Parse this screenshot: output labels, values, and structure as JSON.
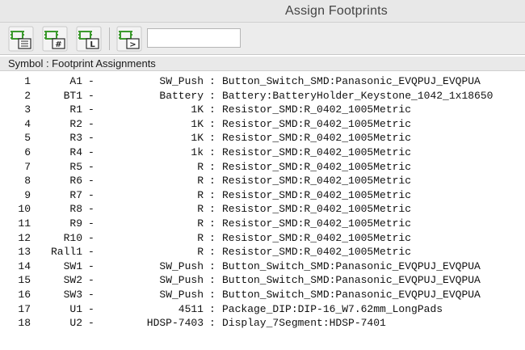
{
  "window": {
    "title": "Assign Footprints"
  },
  "toolbar": {
    "buttons": [
      {
        "name": "view-symbol-list",
        "label": ""
      },
      {
        "name": "filter-by-pin-count",
        "label": "#"
      },
      {
        "name": "filter-by-library",
        "label": "L"
      },
      {
        "name": "filter-by-text",
        "label": ">"
      }
    ],
    "filter_value": "",
    "filter_placeholder": ""
  },
  "panel": {
    "header": "Symbol : Footprint Assignments"
  },
  "separators": {
    "dash": "-",
    "colon": ":"
  },
  "colors": {
    "icon_green": "#3c9a2e",
    "icon_dark": "#2a2a2a",
    "icon_bg": "#f4f4f4"
  },
  "rows": [
    {
      "num": "1",
      "ref": "A1",
      "value": "SW_Push",
      "footprint": "Button_Switch_SMD:Panasonic_EVQPUJ_EVQPUA"
    },
    {
      "num": "2",
      "ref": "BT1",
      "value": "Battery",
      "footprint": "Battery:BatteryHolder_Keystone_1042_1x18650"
    },
    {
      "num": "3",
      "ref": "R1",
      "value": "1K",
      "footprint": "Resistor_SMD:R_0402_1005Metric"
    },
    {
      "num": "4",
      "ref": "R2",
      "value": "1K",
      "footprint": "Resistor_SMD:R_0402_1005Metric"
    },
    {
      "num": "5",
      "ref": "R3",
      "value": "1K",
      "footprint": "Resistor_SMD:R_0402_1005Metric"
    },
    {
      "num": "6",
      "ref": "R4",
      "value": "1k",
      "footprint": "Resistor_SMD:R_0402_1005Metric"
    },
    {
      "num": "7",
      "ref": "R5",
      "value": "R",
      "footprint": "Resistor_SMD:R_0402_1005Metric"
    },
    {
      "num": "8",
      "ref": "R6",
      "value": "R",
      "footprint": "Resistor_SMD:R_0402_1005Metric"
    },
    {
      "num": "9",
      "ref": "R7",
      "value": "R",
      "footprint": "Resistor_SMD:R_0402_1005Metric"
    },
    {
      "num": "10",
      "ref": "R8",
      "value": "R",
      "footprint": "Resistor_SMD:R_0402_1005Metric"
    },
    {
      "num": "11",
      "ref": "R9",
      "value": "R",
      "footprint": "Resistor_SMD:R_0402_1005Metric"
    },
    {
      "num": "12",
      "ref": "R10",
      "value": "R",
      "footprint": "Resistor_SMD:R_0402_1005Metric"
    },
    {
      "num": "13",
      "ref": "Rall1",
      "value": "R",
      "footprint": "Resistor_SMD:R_0402_1005Metric"
    },
    {
      "num": "14",
      "ref": "SW1",
      "value": "SW_Push",
      "footprint": "Button_Switch_SMD:Panasonic_EVQPUJ_EVQPUA"
    },
    {
      "num": "15",
      "ref": "SW2",
      "value": "SW_Push",
      "footprint": "Button_Switch_SMD:Panasonic_EVQPUJ_EVQPUA"
    },
    {
      "num": "16",
      "ref": "SW3",
      "value": "SW_Push",
      "footprint": "Button_Switch_SMD:Panasonic_EVQPUJ_EVQPUA"
    },
    {
      "num": "17",
      "ref": "U1",
      "value": "4511",
      "footprint": "Package_DIP:DIP-16_W7.62mm_LongPads"
    },
    {
      "num": "18",
      "ref": "U2",
      "value": "HDSP-7403",
      "footprint": "Display_7Segment:HDSP-7401"
    }
  ]
}
